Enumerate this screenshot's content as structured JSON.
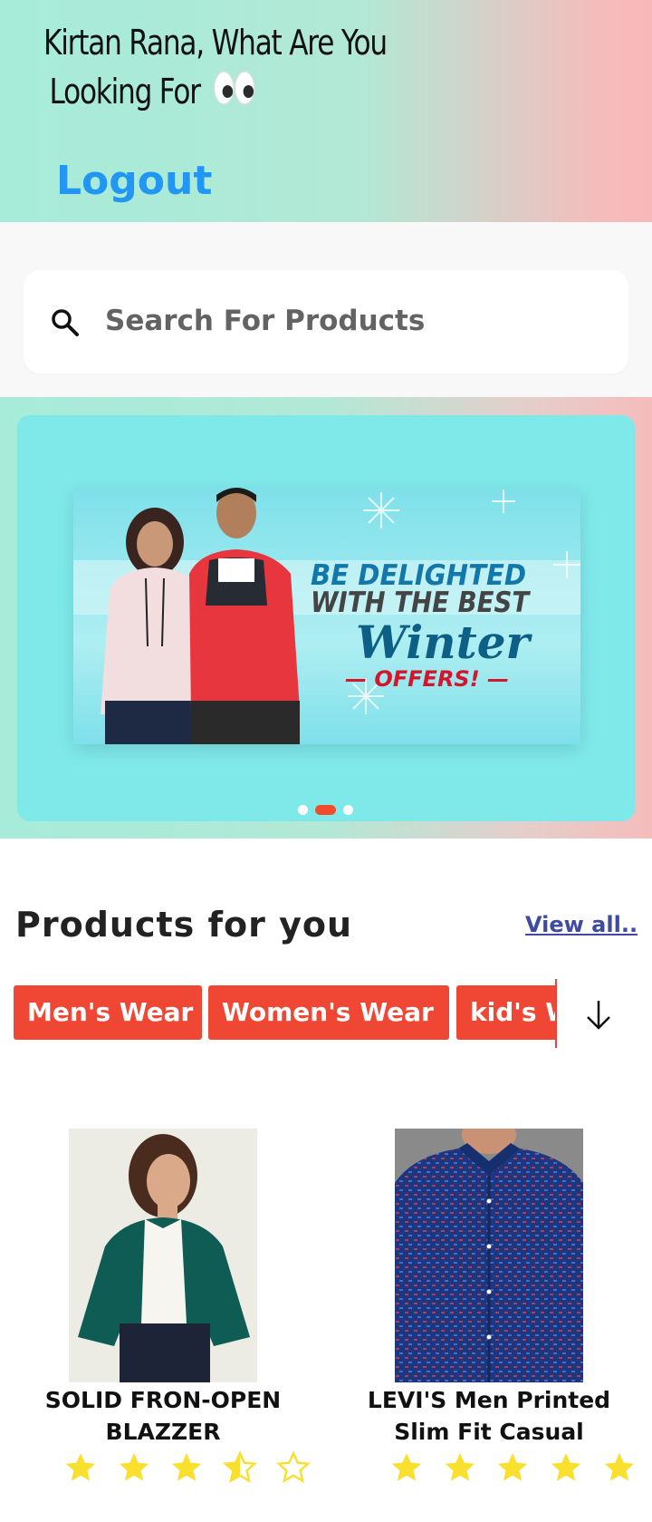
{
  "header": {
    "greeting_line1": "Kirtan  Rana, What Are You",
    "greeting_line2": "Looking For",
    "greeting_emoji": "👀",
    "logout_label": "Logout",
    "gradient_colors": [
      "#a6ecd9",
      "#f8b8b8"
    ]
  },
  "search": {
    "placeholder": "Search For Products",
    "icon": "search-icon"
  },
  "banner": {
    "line1": "BE DELIGHTED",
    "line2": "WITH THE BEST",
    "line3": "Winter",
    "line4": "— OFFERS! —",
    "carousel_dots": 3,
    "active_dot": 2,
    "accent_color": "#f04e2a"
  },
  "products_section": {
    "title": "Products for you",
    "view_all_label": "View all..",
    "categories": [
      "Men's Wear",
      "Women's Wear",
      "kid's Wear"
    ],
    "expand_icon": "arrow-down-icon",
    "chip_color": "#ef4733"
  },
  "products": [
    {
      "title_line1": "SOLID FRON-OPEN",
      "title_line2": "BLAZZER",
      "rating": 3.5,
      "rating_max": 5
    },
    {
      "title_line1": "LEVI'S Men Printed",
      "title_line2": "Slim Fit Casual",
      "rating": 5,
      "rating_max": 5
    }
  ]
}
